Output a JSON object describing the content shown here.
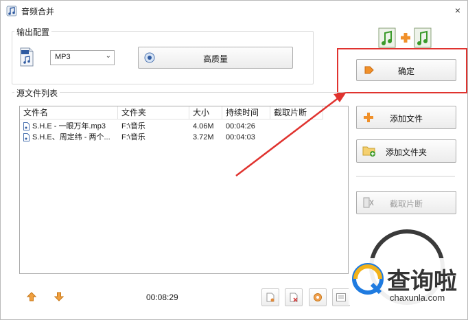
{
  "window": {
    "title": "音频合并",
    "close_glyph": "×"
  },
  "output_config": {
    "group_title": "输出配置",
    "format_value": "MP3",
    "quality_label": "高质量"
  },
  "source_list": {
    "group_title": "源文件列表",
    "columns": [
      "文件名",
      "文件夹",
      "大小",
      "持续时间",
      "截取片断"
    ],
    "rows": [
      {
        "name": "S.H.E - 一眼万年.mp3",
        "folder": "F:\\音乐",
        "size": "4.06M",
        "duration": "00:04:26",
        "clip": ""
      },
      {
        "name": "S.H.E、周定纬 - 两个...",
        "folder": "F:\\音乐",
        "size": "3.72M",
        "duration": "00:04:03",
        "clip": ""
      }
    ],
    "total_duration": "00:08:29"
  },
  "actions": {
    "confirm_label": "确定",
    "add_file_label": "添加文件",
    "add_folder_label": "添加文件夹",
    "clip_label": "截取片断"
  },
  "watermark": {
    "brand": "查询啦",
    "url": "chaxunla.com"
  },
  "colors": {
    "accent_red": "#e0332f",
    "orange": "#f0902a",
    "green": "#3a9a2a"
  }
}
